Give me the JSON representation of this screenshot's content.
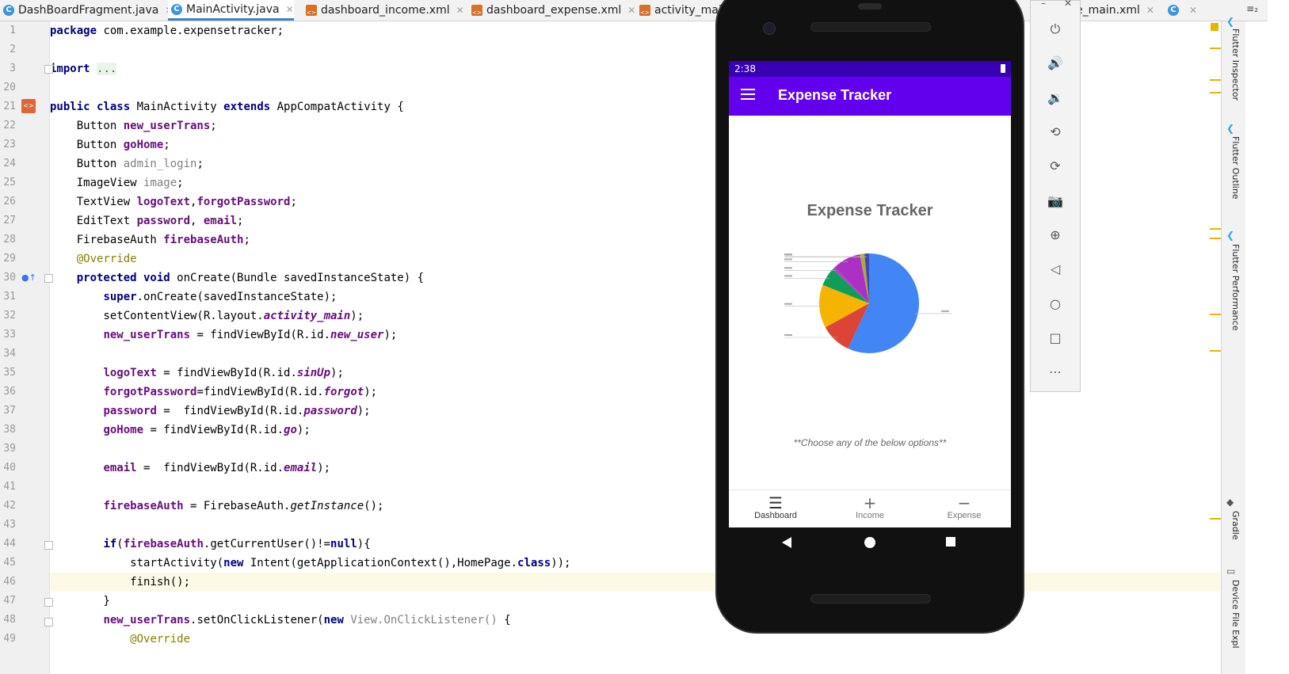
{
  "tabs": [
    {
      "label": "DashBoardFragment.java",
      "icon": "java-class-icon"
    },
    {
      "label": "MainActivity.java",
      "icon": "java-class-icon",
      "active": true
    },
    {
      "label": "dashboard_income.xml",
      "icon": "xml-layout-icon"
    },
    {
      "label": "dashboard_expense.xml",
      "icon": "xml-layout-icon"
    },
    {
      "label": "activity_mai",
      "icon": "xml-layout-icon"
    },
    {
      "label": "e_main.xml",
      "icon": "xml-layout-icon"
    }
  ],
  "tab_overflow": "≡₂",
  "editor": {
    "current_line": 46,
    "lines": [
      {
        "n": "1",
        "text": "package com.example.expensetracker;"
      },
      {
        "n": "2",
        "text": ""
      },
      {
        "n": "3",
        "text": "import ..."
      },
      {
        "n": "20",
        "text": ""
      },
      {
        "n": "21",
        "text": "public class MainActivity extends AppCompatActivity {"
      },
      {
        "n": "22",
        "text": "    Button new_userTrans;"
      },
      {
        "n": "23",
        "text": "    Button goHome;"
      },
      {
        "n": "24",
        "text": "    Button admin_login;"
      },
      {
        "n": "25",
        "text": "    ImageView image;"
      },
      {
        "n": "26",
        "text": "    TextView logoText,forgotPassword;"
      },
      {
        "n": "27",
        "text": "    EditText password, email;"
      },
      {
        "n": "28",
        "text": "    FirebaseAuth firebaseAuth;"
      },
      {
        "n": "29",
        "text": "    @Override"
      },
      {
        "n": "30",
        "text": "    protected void onCreate(Bundle savedInstanceState) {"
      },
      {
        "n": "31",
        "text": "        super.onCreate(savedInstanceState);"
      },
      {
        "n": "32",
        "text": "        setContentView(R.layout.activity_main);"
      },
      {
        "n": "33",
        "text": "        new_userTrans = findViewById(R.id.new_user);"
      },
      {
        "n": "34",
        "text": ""
      },
      {
        "n": "35",
        "text": "        logoText = findViewById(R.id.sinUp);"
      },
      {
        "n": "36",
        "text": "        forgotPassword=findViewById(R.id.forgot);"
      },
      {
        "n": "37",
        "text": "        password =  findViewById(R.id.password);"
      },
      {
        "n": "38",
        "text": "        goHome = findViewById(R.id.go);"
      },
      {
        "n": "39",
        "text": ""
      },
      {
        "n": "40",
        "text": "        email =  findViewById(R.id.email);"
      },
      {
        "n": "41",
        "text": ""
      },
      {
        "n": "42",
        "text": "        firebaseAuth = FirebaseAuth.getInstance();"
      },
      {
        "n": "43",
        "text": ""
      },
      {
        "n": "44",
        "text": "        if(firebaseAuth.getCurrentUser()!=null){"
      },
      {
        "n": "45",
        "text": "            startActivity(new Intent(getApplicationContext(),HomePage.class));"
      },
      {
        "n": "46",
        "text": "            finish();"
      },
      {
        "n": "47",
        "text": "        }"
      },
      {
        "n": "48",
        "text": "        new_userTrans.setOnClickListener(new View.OnClickListener() {"
      },
      {
        "n": "49",
        "text": "            @Override"
      }
    ]
  },
  "right_panel": {
    "labels": [
      "Flutter Inspector",
      "Flutter Outline",
      "Flutter Performance",
      "Gradle",
      "Device File Expl"
    ]
  },
  "emulator": {
    "status_time": "2:38",
    "app_title": "Expense Tracker",
    "chart_title": "Expense Tracker",
    "hint": "**Choose any of the below options**",
    "nav": [
      {
        "label": "Dashboard",
        "icon": "menu-icon"
      },
      {
        "label": "Income",
        "icon": "plus-icon"
      },
      {
        "label": "Expense",
        "icon": "minus-icon"
      }
    ],
    "toolbar": [
      "power-icon",
      "volume-up-icon",
      "volume-down-icon",
      "rotate-left-icon",
      "rotate-right-icon",
      "camera-icon",
      "zoom-icon",
      "back-icon",
      "home-icon",
      "overview-icon",
      "more-icon"
    ]
  },
  "chart_data": {
    "type": "pie",
    "title": "Expense Tracker",
    "series": [
      {
        "values": [
          57,
          10,
          14,
          6,
          1,
          9,
          1.5,
          1.5
        ]
      }
    ],
    "colors": [
      "#4285f4",
      "#db4437",
      "#f4b400",
      "#0f9d58",
      "#ab47bc",
      "#ab30c4",
      "#b0a93c",
      "#3c4ab0"
    ],
    "legend": "slice labels too small to read"
  }
}
